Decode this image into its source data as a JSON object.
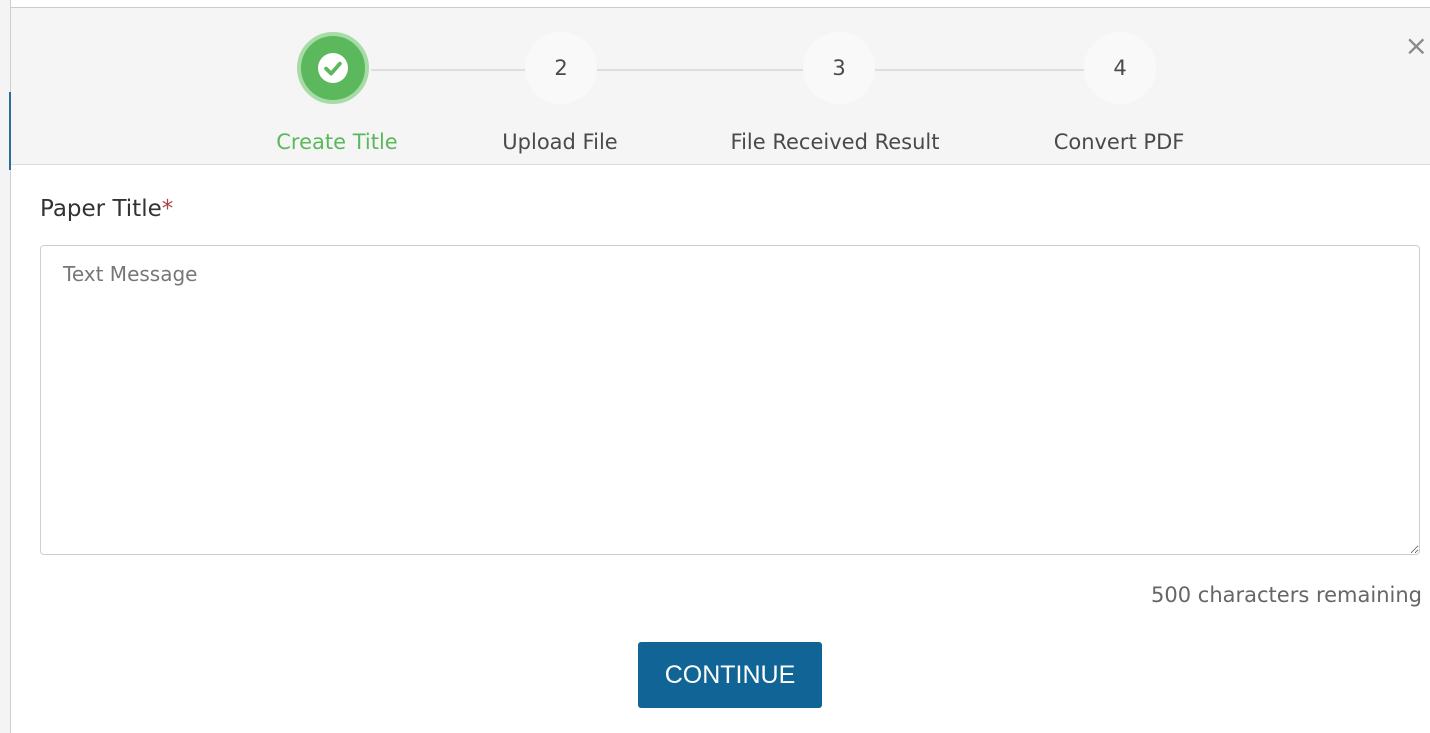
{
  "stepper": {
    "steps": [
      {
        "number": "",
        "label": "Create Title",
        "state": "completed",
        "icon": "check-icon"
      },
      {
        "number": "2",
        "label": "Upload File",
        "state": "pending"
      },
      {
        "number": "3",
        "label": "File Received Result",
        "state": "pending"
      },
      {
        "number": "4",
        "label": "Convert PDF",
        "state": "pending"
      }
    ],
    "close_label": "×"
  },
  "form": {
    "field_label": "Paper Title",
    "required_mark": "*",
    "placeholder": "Text Message",
    "value": "",
    "counter": "500 characters remaining",
    "continue_label": "CONTINUE"
  },
  "colors": {
    "completed_step": "#5cb85c",
    "primary_button": "#116496",
    "required": "#a94442"
  }
}
